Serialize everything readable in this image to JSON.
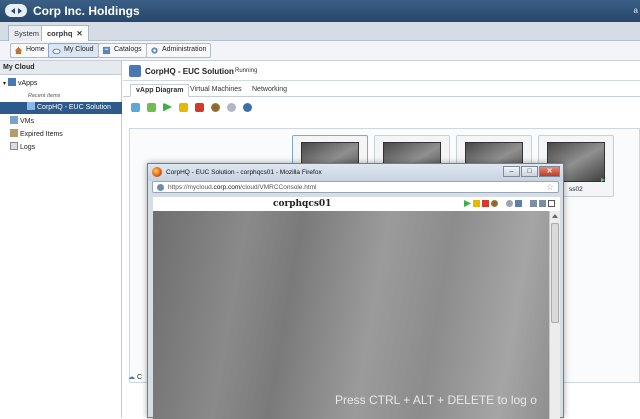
{
  "app": {
    "title": "Corp Inc. Holdings",
    "top_right_text": "a"
  },
  "org_tabs": [
    {
      "label": "System"
    },
    {
      "label": "corphq",
      "close": "✕"
    }
  ],
  "toolbar": {
    "home": "Home",
    "my_cloud": "My Cloud",
    "catalogs": "Catalogs",
    "administration": "Administration"
  },
  "left_pane": {
    "header": "My Cloud",
    "vapps": "vApps",
    "recent_items": "Recent Items",
    "selected_vapp": "CorpHQ - EUC Solution",
    "vms": "VMs",
    "expired_items": "Expired Items",
    "logs": "Logs"
  },
  "vapp": {
    "title": "CorpHQ - EUC Solution",
    "status": "Running",
    "tabs": [
      "vApp Diagram",
      "Virtual Machines",
      "Networking"
    ]
  },
  "vm_cards": [
    {
      "label": ""
    },
    {
      "label": ""
    },
    {
      "label": ""
    },
    {
      "label": "ss02"
    }
  ],
  "lower_label": "C",
  "console": {
    "window_title": "CorpHQ - EUC Solution - corphqcs01 - Mozilla Firefox",
    "url_prefix": "https://mycloud.",
    "url_domain": "corp.com",
    "url_suffix": "/cloud/VMRCConsole.html",
    "hostname": "corphqcs01",
    "message": "Press CTRL + ALT + DELETE to log o",
    "window_buttons": {
      "min": "–",
      "max": "□",
      "close": "✕"
    }
  },
  "colors": {
    "topbar": "#2f5279",
    "selection": "#2d5a8c",
    "play": "#3cb043",
    "pause": "#e6b800",
    "stop": "#d23a2a"
  }
}
